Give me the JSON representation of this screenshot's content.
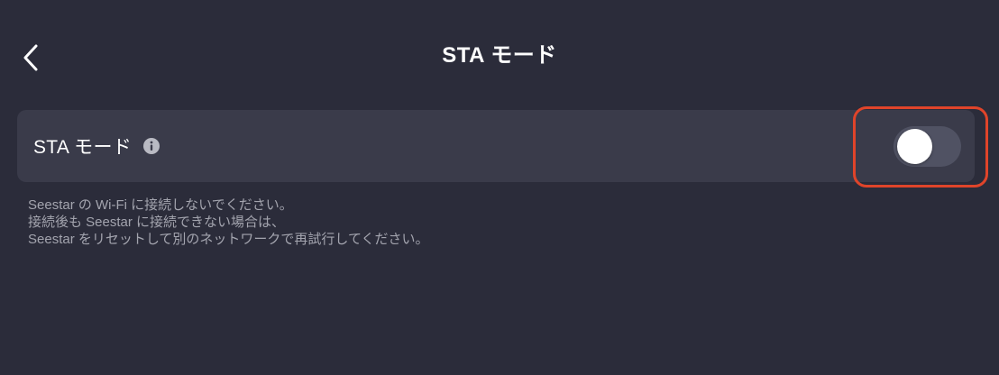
{
  "header": {
    "title": "STA モード",
    "back_icon": "chevron-left-icon"
  },
  "setting": {
    "label": "STA モード",
    "info_icon": "info-icon",
    "toggle_state": "off",
    "highlight_color": "#e0442a"
  },
  "help": {
    "lines": [
      "Seestar の Wi-Fi に接続しないでください。",
      "接続後も Seestar に接続できない場合は、",
      "Seestar をリセットして別のネットワークで再試行してください。"
    ]
  },
  "colors": {
    "background": "#2b2c3a",
    "row_background": "#3a3b4a",
    "toggle_track_off": "#505263"
  }
}
